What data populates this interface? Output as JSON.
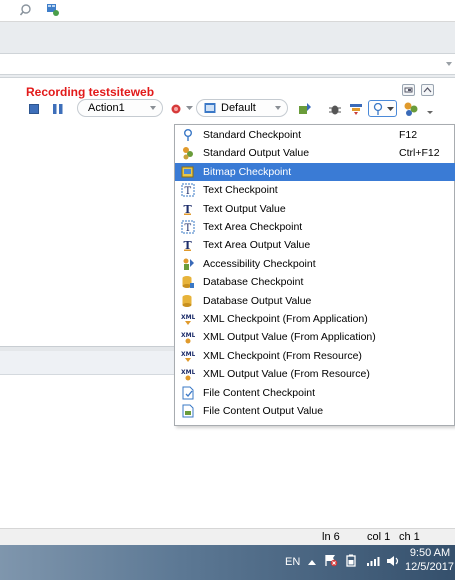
{
  "recording": {
    "title": "Recording testsiteweb"
  },
  "toolbar": {
    "action_label": "Action1",
    "default_label": "Default"
  },
  "menu": {
    "items": [
      {
        "label": "Standard Checkpoint",
        "shortcut": "F12",
        "icon": "checkpoint-pin-icon"
      },
      {
        "label": "Standard Output Value",
        "shortcut": "Ctrl+F12",
        "icon": "output-value-icon"
      },
      {
        "label": "Bitmap Checkpoint",
        "shortcut": "",
        "icon": "bitmap-checkpoint-icon",
        "selected": true
      },
      {
        "label": "Text Checkpoint",
        "shortcut": "",
        "icon": "text-checkpoint-icon"
      },
      {
        "label": "Text Output Value",
        "shortcut": "",
        "icon": "text-output-icon"
      },
      {
        "label": "Text Area Checkpoint",
        "shortcut": "",
        "icon": "text-area-checkpoint-icon"
      },
      {
        "label": "Text Area Output Value",
        "shortcut": "",
        "icon": "text-area-output-icon"
      },
      {
        "label": "Accessibility Checkpoint",
        "shortcut": "",
        "icon": "accessibility-icon"
      },
      {
        "label": "Database Checkpoint",
        "shortcut": "",
        "icon": "database-checkpoint-icon"
      },
      {
        "label": "Database Output Value",
        "shortcut": "",
        "icon": "database-output-icon"
      },
      {
        "label": "XML Checkpoint (From Application)",
        "shortcut": "",
        "icon": "xml-checkpoint-icon"
      },
      {
        "label": "XML Output Value (From Application)",
        "shortcut": "",
        "icon": "xml-output-icon"
      },
      {
        "label": "XML Checkpoint (From Resource)",
        "shortcut": "",
        "icon": "xml-checkpoint-icon"
      },
      {
        "label": "XML Output Value (From Resource)",
        "shortcut": "",
        "icon": "xml-output-icon"
      },
      {
        "label": "File Content Checkpoint",
        "shortcut": "",
        "icon": "file-checkpoint-icon"
      },
      {
        "label": "File Content Output Value",
        "shortcut": "",
        "icon": "file-output-icon"
      }
    ]
  },
  "status_bar": {
    "line": "ln 6",
    "col": "col 1",
    "ch": "ch 1"
  },
  "taskbar": {
    "lang": "EN",
    "time": "9:50 AM",
    "date": "12/5/2017"
  },
  "colors": {
    "recording_red": "#e21a1a",
    "selection_blue": "#3a7bd5"
  }
}
